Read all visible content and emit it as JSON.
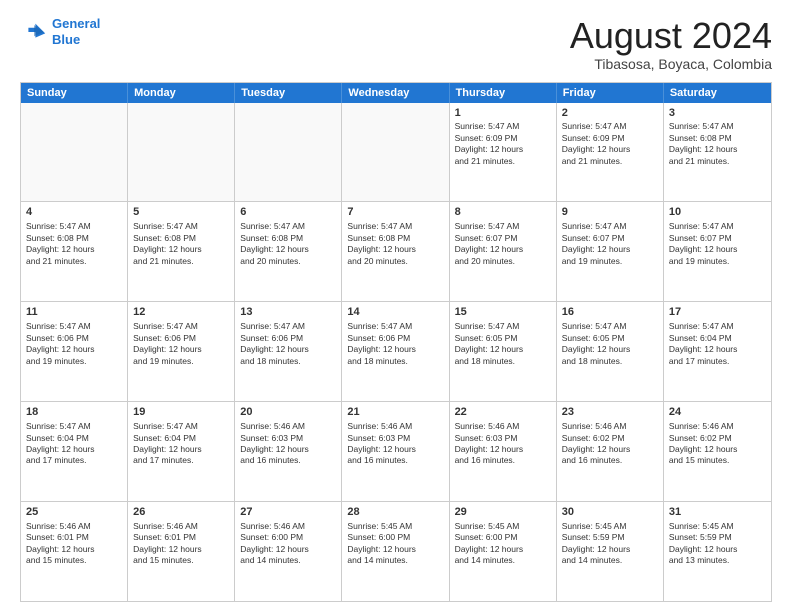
{
  "header": {
    "logo_line1": "General",
    "logo_line2": "Blue",
    "month_year": "August 2024",
    "subtitle": "Tibasosa, Boyaca, Colombia"
  },
  "days_of_week": [
    "Sunday",
    "Monday",
    "Tuesday",
    "Wednesday",
    "Thursday",
    "Friday",
    "Saturday"
  ],
  "rows": [
    [
      {
        "day": "",
        "text": "",
        "empty": true
      },
      {
        "day": "",
        "text": "",
        "empty": true
      },
      {
        "day": "",
        "text": "",
        "empty": true
      },
      {
        "day": "",
        "text": "",
        "empty": true
      },
      {
        "day": "1",
        "text": "Sunrise: 5:47 AM\nSunset: 6:09 PM\nDaylight: 12 hours\nand 21 minutes."
      },
      {
        "day": "2",
        "text": "Sunrise: 5:47 AM\nSunset: 6:09 PM\nDaylight: 12 hours\nand 21 minutes."
      },
      {
        "day": "3",
        "text": "Sunrise: 5:47 AM\nSunset: 6:08 PM\nDaylight: 12 hours\nand 21 minutes."
      }
    ],
    [
      {
        "day": "4",
        "text": "Sunrise: 5:47 AM\nSunset: 6:08 PM\nDaylight: 12 hours\nand 21 minutes."
      },
      {
        "day": "5",
        "text": "Sunrise: 5:47 AM\nSunset: 6:08 PM\nDaylight: 12 hours\nand 21 minutes."
      },
      {
        "day": "6",
        "text": "Sunrise: 5:47 AM\nSunset: 6:08 PM\nDaylight: 12 hours\nand 20 minutes."
      },
      {
        "day": "7",
        "text": "Sunrise: 5:47 AM\nSunset: 6:08 PM\nDaylight: 12 hours\nand 20 minutes."
      },
      {
        "day": "8",
        "text": "Sunrise: 5:47 AM\nSunset: 6:07 PM\nDaylight: 12 hours\nand 20 minutes."
      },
      {
        "day": "9",
        "text": "Sunrise: 5:47 AM\nSunset: 6:07 PM\nDaylight: 12 hours\nand 19 minutes."
      },
      {
        "day": "10",
        "text": "Sunrise: 5:47 AM\nSunset: 6:07 PM\nDaylight: 12 hours\nand 19 minutes."
      }
    ],
    [
      {
        "day": "11",
        "text": "Sunrise: 5:47 AM\nSunset: 6:06 PM\nDaylight: 12 hours\nand 19 minutes."
      },
      {
        "day": "12",
        "text": "Sunrise: 5:47 AM\nSunset: 6:06 PM\nDaylight: 12 hours\nand 19 minutes."
      },
      {
        "day": "13",
        "text": "Sunrise: 5:47 AM\nSunset: 6:06 PM\nDaylight: 12 hours\nand 18 minutes."
      },
      {
        "day": "14",
        "text": "Sunrise: 5:47 AM\nSunset: 6:06 PM\nDaylight: 12 hours\nand 18 minutes."
      },
      {
        "day": "15",
        "text": "Sunrise: 5:47 AM\nSunset: 6:05 PM\nDaylight: 12 hours\nand 18 minutes."
      },
      {
        "day": "16",
        "text": "Sunrise: 5:47 AM\nSunset: 6:05 PM\nDaylight: 12 hours\nand 18 minutes."
      },
      {
        "day": "17",
        "text": "Sunrise: 5:47 AM\nSunset: 6:04 PM\nDaylight: 12 hours\nand 17 minutes."
      }
    ],
    [
      {
        "day": "18",
        "text": "Sunrise: 5:47 AM\nSunset: 6:04 PM\nDaylight: 12 hours\nand 17 minutes."
      },
      {
        "day": "19",
        "text": "Sunrise: 5:47 AM\nSunset: 6:04 PM\nDaylight: 12 hours\nand 17 minutes."
      },
      {
        "day": "20",
        "text": "Sunrise: 5:46 AM\nSunset: 6:03 PM\nDaylight: 12 hours\nand 16 minutes."
      },
      {
        "day": "21",
        "text": "Sunrise: 5:46 AM\nSunset: 6:03 PM\nDaylight: 12 hours\nand 16 minutes."
      },
      {
        "day": "22",
        "text": "Sunrise: 5:46 AM\nSunset: 6:03 PM\nDaylight: 12 hours\nand 16 minutes."
      },
      {
        "day": "23",
        "text": "Sunrise: 5:46 AM\nSunset: 6:02 PM\nDaylight: 12 hours\nand 16 minutes."
      },
      {
        "day": "24",
        "text": "Sunrise: 5:46 AM\nSunset: 6:02 PM\nDaylight: 12 hours\nand 15 minutes."
      }
    ],
    [
      {
        "day": "25",
        "text": "Sunrise: 5:46 AM\nSunset: 6:01 PM\nDaylight: 12 hours\nand 15 minutes."
      },
      {
        "day": "26",
        "text": "Sunrise: 5:46 AM\nSunset: 6:01 PM\nDaylight: 12 hours\nand 15 minutes."
      },
      {
        "day": "27",
        "text": "Sunrise: 5:46 AM\nSunset: 6:00 PM\nDaylight: 12 hours\nand 14 minutes."
      },
      {
        "day": "28",
        "text": "Sunrise: 5:45 AM\nSunset: 6:00 PM\nDaylight: 12 hours\nand 14 minutes."
      },
      {
        "day": "29",
        "text": "Sunrise: 5:45 AM\nSunset: 6:00 PM\nDaylight: 12 hours\nand 14 minutes."
      },
      {
        "day": "30",
        "text": "Sunrise: 5:45 AM\nSunset: 5:59 PM\nDaylight: 12 hours\nand 14 minutes."
      },
      {
        "day": "31",
        "text": "Sunrise: 5:45 AM\nSunset: 5:59 PM\nDaylight: 12 hours\nand 13 minutes."
      }
    ]
  ]
}
